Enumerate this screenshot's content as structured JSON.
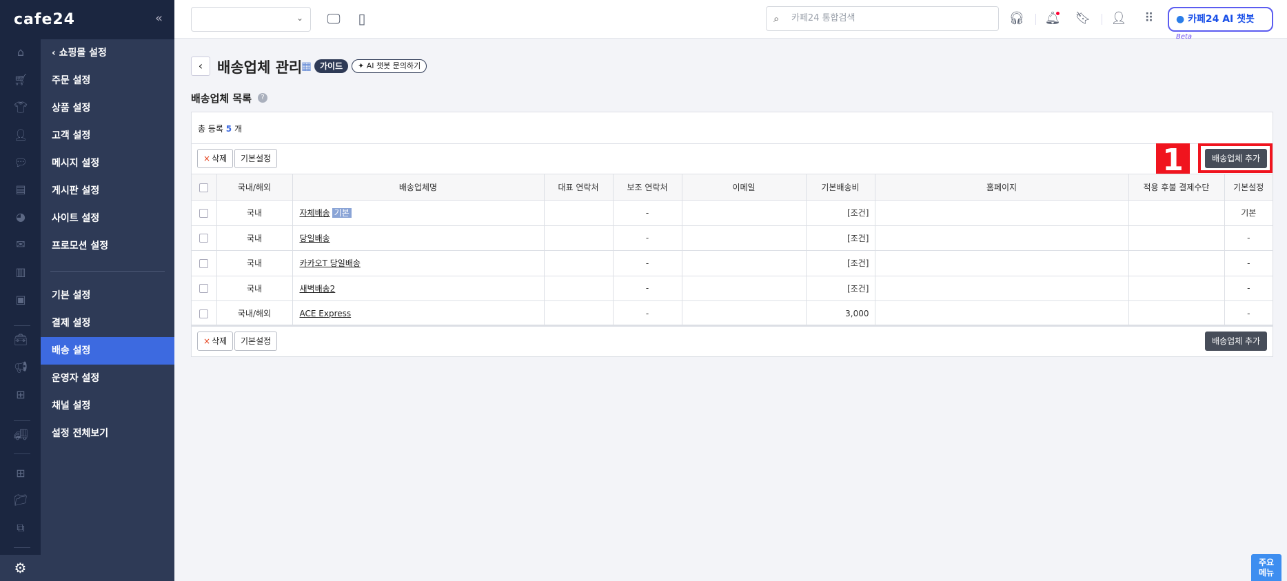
{
  "brand": {
    "logo": "cafe24",
    "collapse_icon": "«"
  },
  "rail": {
    "icons": [
      "home-icon",
      "cart-icon",
      "tshirt-icon",
      "person-icon",
      "chat-icon",
      "board-icon",
      "palette-icon",
      "promotion-icon",
      "chart-icon",
      "excel-icon",
      "toolbox-icon",
      "megaphone-icon",
      "store-add-icon",
      "truck-icon",
      "apps-add-icon",
      "folder-add-icon",
      "link-icon"
    ],
    "settings_icon": "gear-icon"
  },
  "submenu": {
    "back_label": "쇼핑몰 설정",
    "group1": [
      "주문 설정",
      "상품 설정",
      "고객 설정",
      "메시지 설정",
      "게시판 설정",
      "사이트 설정",
      "프로모션 설정"
    ],
    "group2": [
      "기본 설정",
      "결제 설정",
      "배송 설정",
      "운영자 설정",
      "채널 설정",
      "설정 전체보기"
    ],
    "active": "배송 설정"
  },
  "topbar": {
    "shop_select_value": "",
    "search_placeholder": "카페24 통합검색",
    "ai_button": "카페24 AI 챗봇",
    "ai_beta": "Beta"
  },
  "page": {
    "title": "배송업체 관리",
    "guide_badge": "가이드",
    "ai_ask": "AI 챗봇 문의하기",
    "list_title": "배송업체 목록",
    "help": "?"
  },
  "list": {
    "count_prefix": "총 등록",
    "count": "5",
    "count_suffix": "개",
    "delete_label": "삭제",
    "default_label": "기본설정",
    "add_label": "배송업체 추가",
    "annotation": "1",
    "columns": [
      "국내/해외",
      "배송업체명",
      "대표 연락처",
      "보조 연락처",
      "이메일",
      "기본배송비",
      "홈페이지",
      "적용 후불 결제수단",
      "기본설정"
    ],
    "rows": [
      {
        "region": "국내",
        "name": "자체배송",
        "badge": "기본",
        "phone": "",
        "phone2": "-",
        "email": "",
        "fee": "[조건]",
        "homepage": "",
        "postpay": "",
        "default": "기본"
      },
      {
        "region": "국내",
        "name": "당일배송",
        "badge": "",
        "phone": "",
        "phone2": "-",
        "email": "",
        "fee": "[조건]",
        "homepage": "",
        "postpay": "",
        "default": "-"
      },
      {
        "region": "국내",
        "name": "카카오T 당일배송",
        "badge": "",
        "phone": "",
        "phone2": "-",
        "email": "",
        "fee": "[조건]",
        "homepage": "",
        "postpay": "",
        "default": "-"
      },
      {
        "region": "국내",
        "name": "새벽배송2",
        "badge": "",
        "phone": "",
        "phone2": "-",
        "email": "",
        "fee": "[조건]",
        "homepage": "",
        "postpay": "",
        "default": "-"
      },
      {
        "region": "국내/해외",
        "name": "ACE Express",
        "badge": "",
        "phone": "",
        "phone2": "-",
        "email": "",
        "fee": "3,000",
        "homepage": "",
        "postpay": "",
        "default": "-"
      }
    ]
  },
  "footer": {
    "main_menu": "주요\n메뉴"
  },
  "colors": {
    "accent": "#3d6ae0",
    "sidebar": "#2e3a56",
    "rail": "#1b2640",
    "highlight": "#f0141e"
  }
}
